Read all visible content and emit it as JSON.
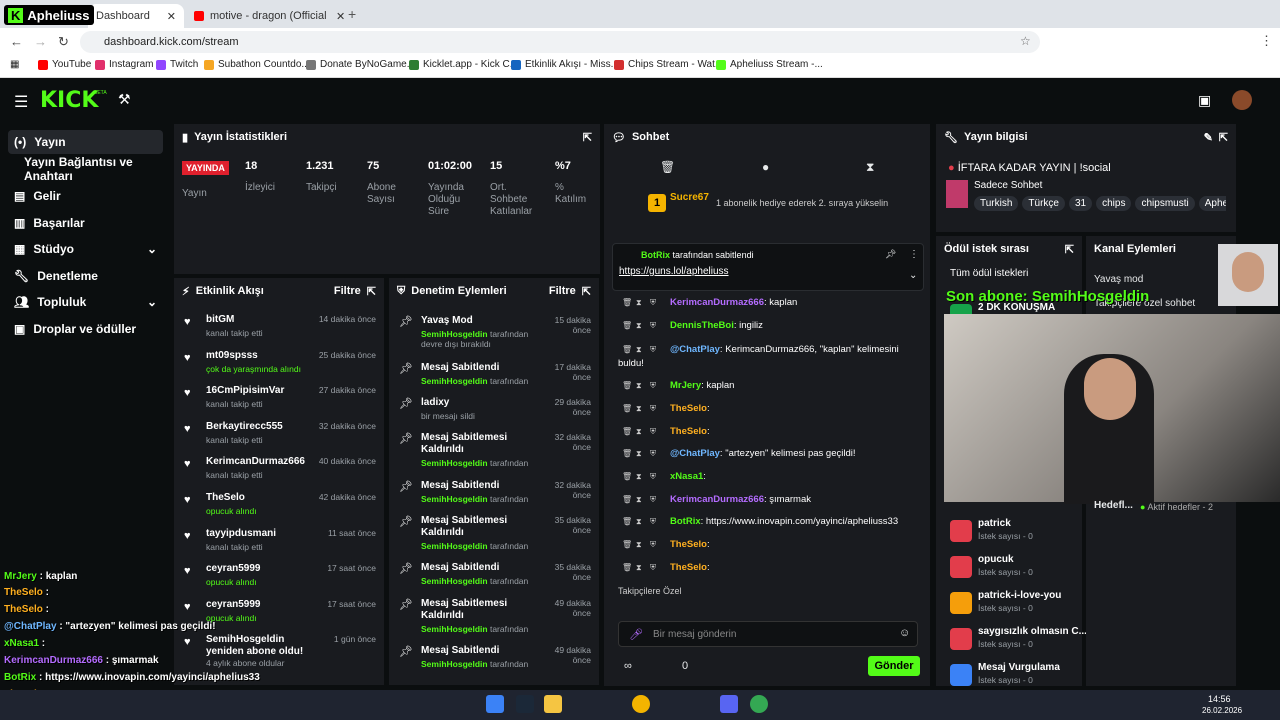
{
  "browser": {
    "tabs": [
      {
        "label": "Dashboard",
        "active": true
      },
      {
        "label": "motive - dragon (Official Music",
        "active": false
      }
    ],
    "url": "dashboard.kick.com/stream",
    "bookmarks": [
      "YouTube",
      "Instagram",
      "Twitch",
      "Subathon Countdo...",
      "Donate ByNoGame...",
      "Kicklet.app - Kick C...",
      "Etkinlik Akışı - Miss...",
      "Chips Stream - Wat...",
      "Apheliuss Stream -..."
    ],
    "bookmark_colors": [
      "#ff0000",
      "#e1306c",
      "#9146ff",
      "#f5a623",
      "#777",
      "#2e7d32",
      "#1565c0",
      "#d32f2f",
      "#53fc18"
    ]
  },
  "channel_badge": "Apheliuss",
  "brand": {
    "logo": "KICK",
    "beta": "BETA",
    "accent": "#53fc18"
  },
  "sidebar": {
    "items": [
      {
        "label": "Yayın",
        "icon": "broadcast-icon"
      },
      {
        "label": "Yayın Bağlantısı ve Anahtarı",
        "icon": ""
      },
      {
        "label": "Gelir",
        "icon": "dollar-icon"
      },
      {
        "label": "Başarılar",
        "icon": "trophy-icon"
      },
      {
        "label": "Stüdyo",
        "icon": "studio-icon"
      },
      {
        "label": "Denetleme",
        "icon": "wrench-icon"
      },
      {
        "label": "Topluluk",
        "icon": "users-icon"
      },
      {
        "label": "Droplar ve ödüller",
        "icon": "gift-icon"
      }
    ]
  },
  "stats": {
    "title": "Yayın İstatistikleri",
    "live_badge": "YAYINDA",
    "live_label": "Yayın",
    "items": [
      {
        "value": "18",
        "label": "İzleyici"
      },
      {
        "value": "1.231",
        "label": "Takipçi"
      },
      {
        "value": "75",
        "label": "Abone Sayısı"
      },
      {
        "value": "01:02:00",
        "label": "Yayında Olduğu Süre"
      },
      {
        "value": "15",
        "label": "Ort. Sohbete Katılanlar"
      },
      {
        "value": "%7",
        "label": "% Katılım"
      }
    ]
  },
  "activity": {
    "title": "Etkinlik Akışı",
    "filter": "Filtre",
    "items": [
      {
        "name": "bitGM",
        "desc": "kanalı takip etti",
        "time": "14 dakika önce"
      },
      {
        "name": "mt09spsss",
        "desc": "çok da yaraşmında alındı",
        "time": "25 dakika önce"
      },
      {
        "name": "16CmPipisimVar",
        "desc": "kanalı takip etti",
        "time": "27 dakika önce"
      },
      {
        "name": "Berkaytirecc555",
        "desc": "kanalı takip etti",
        "time": "32 dakika önce"
      },
      {
        "name": "KerimcanDurmaz666",
        "desc": "kanalı takip etti",
        "time": "40 dakika önce"
      },
      {
        "name": "TheSelo",
        "desc": "opucuk alındı",
        "time": "42 dakika önce"
      },
      {
        "name": "tayyipdusmani",
        "desc": "kanalı takip etti",
        "time": "11 saat önce"
      },
      {
        "name": "ceyran5999",
        "desc": "opucuk alındı",
        "time": "17 saat önce"
      },
      {
        "name": "ceyran5999",
        "desc": "opucuk alındı",
        "time": "17 saat önce"
      },
      {
        "name": "SemihHosgeldin yeniden abone oldu!",
        "desc": "4 aylık abone oldular",
        "time": "1 gün önce"
      }
    ]
  },
  "moderation": {
    "title": "Denetim Eylemleri",
    "filter": "Filtre",
    "items": [
      {
        "title": "Yavaş Mod",
        "user": "SemihHosgeldin",
        "desc": "tarafından devre dışı bırakıldı",
        "time": "15 dakika önce"
      },
      {
        "title": "Mesaj Sabitlendi",
        "user": "SemihHosgeldin",
        "desc": "tarafından",
        "time": "17 dakika önce"
      },
      {
        "title": "ladixy",
        "user": "",
        "desc": "bir mesajı sildi",
        "time": "29 dakika önce"
      },
      {
        "title": "Mesaj Sabitlemesi Kaldırıldı",
        "user": "SemihHosgeldin",
        "desc": "tarafından",
        "time": "32 dakika önce"
      },
      {
        "title": "Mesaj Sabitlendi",
        "user": "SemihHosgeldin",
        "desc": "tarafından",
        "time": "32 dakika önce"
      },
      {
        "title": "Mesaj Sabitlemesi Kaldırıldı",
        "user": "SemihHosgeldin",
        "desc": "tarafından",
        "time": "35 dakika önce"
      },
      {
        "title": "Mesaj Sabitlendi",
        "user": "SemihHosgeldin",
        "desc": "tarafından",
        "time": "35 dakika önce"
      },
      {
        "title": "Mesaj Sabitlemesi Kaldırıldı",
        "user": "SemihHosgeldin",
        "desc": "tarafından",
        "time": "49 dakika önce"
      },
      {
        "title": "Mesaj Sabitlendi",
        "user": "SemihHosgeldin",
        "desc": "tarafından",
        "time": "49 dakika önce"
      }
    ]
  },
  "chat": {
    "title": "Sohbet",
    "gift_user": "Sucre67",
    "gift_count": "1",
    "gift_text": "1 abonelik hediye ederek 2. sıraya yükselin",
    "pinned_by": "BotRix",
    "pinned_label": "tarafından sabitlendi",
    "pinned_link": "https://guns.lol/apheliuss",
    "messages": [
      {
        "user": "KerimcanDurmaz666",
        "color": "#b46cff",
        "text": ": kaplan"
      },
      {
        "user": "DennisTheBoi",
        "color": "#53fc18",
        "text": ": ingiliz"
      },
      {
        "user": "@ChatPlay",
        "color": "#6fb7ff",
        "text": ": KerimcanDurmaz666, \"kaplan\" kelimesini"
      },
      {
        "user": "",
        "color": "#fff",
        "text": "buldu!"
      },
      {
        "user": "MrJery",
        "color": "#53fc18",
        "text": ": kaplan"
      },
      {
        "user": "TheSelo",
        "color": "#ffb020",
        "text": ":"
      },
      {
        "user": "TheSelo",
        "color": "#ffb020",
        "text": ":"
      },
      {
        "user": "@ChatPlay",
        "color": "#6fb7ff",
        "text": ": \"artezyen\" kelimesi pas geçildi!"
      },
      {
        "user": "xNasa1",
        "color": "#53fc18",
        "text": ":"
      },
      {
        "user": "KerimcanDurmaz666",
        "color": "#b46cff",
        "text": ": şımarmak"
      },
      {
        "user": "BotRix",
        "color": "#53fc18",
        "text": ": https://www.inovapin.com/yayinci/apheliuss33"
      },
      {
        "user": "TheSelo",
        "color": "#ffb020",
        "text": ":"
      },
      {
        "user": "TheSelo",
        "color": "#ffb020",
        "text": ":"
      }
    ],
    "followers_label": "Takipçilere Özel",
    "input_placeholder": "Bir mesaj gönderin",
    "count": "0",
    "send": "Gönder"
  },
  "info": {
    "title": "Yayın bilgisi",
    "stream_title": "İFTARA KADAR YAYIN | !social",
    "category": "Sadece Sohbet",
    "tags": [
      "Turkish",
      "Türkçe",
      "31",
      "chips",
      "chipsmusti",
      "Aphe"
    ]
  },
  "rewards": {
    "title": "Ödül istek sırası",
    "all": "Tüm ödül istekleri",
    "items": [
      {
        "name": "2 DK KONUŞMA",
        "sub": "",
        "color": "#16a34a"
      },
      {
        "name": "patrick",
        "sub": "İstek sayısı - 0",
        "color": "#e23d4b"
      },
      {
        "name": "opucuk",
        "sub": "İstek sayısı - 0",
        "color": "#e23d4b"
      },
      {
        "name": "patrick-i-love-you",
        "sub": "İstek sayısı - 0",
        "color": "#f59e0b"
      },
      {
        "name": "saygısızlık olmasın C...",
        "sub": "İstek sayısı - 0",
        "color": "#e23d4b"
      },
      {
        "name": "Mesaj Vurgulama",
        "sub": "İstek sayısı - 0",
        "color": "#3b82f6"
      }
    ]
  },
  "channel_actions": {
    "title": "Kanal Eylemleri",
    "slow": "Yavaş mod",
    "followers_only": "Takipçilere özel sohbet",
    "goals": "Hedefl...",
    "active_goals": "Aktif hedefler - 2"
  },
  "overlay": {
    "sub_text": "Son abone: SemihHosgeldin",
    "chat": [
      {
        "user": "MrJery",
        "color": "#53fc18",
        "text": " : kaplan"
      },
      {
        "user": "TheSelo",
        "color": "#ffb020",
        "text": " :"
      },
      {
        "user": "TheSelo",
        "color": "#ffb020",
        "text": " :"
      },
      {
        "user": "@ChatPlay",
        "color": "#6fb7ff",
        "text": " : \"artezyen\" kelimesi pas geçildi!"
      },
      {
        "user": "xNasa1",
        "color": "#53fc18",
        "text": " :"
      },
      {
        "user": "KerimcanDurmaz666",
        "color": "#b46cff",
        "text": " : şımarmak"
      },
      {
        "user": "BotRix",
        "color": "#53fc18",
        "text": " : https://www.inovapin.com/yayinci/aphelius33"
      },
      {
        "user": "TheSelo",
        "color": "#ffb020",
        "text": " :"
      },
      {
        "user": "TheSelo",
        "color": "#ffb020",
        "text": " :"
      }
    ]
  },
  "taskbar": {
    "time": "14:56",
    "date": "26.02.2026"
  }
}
